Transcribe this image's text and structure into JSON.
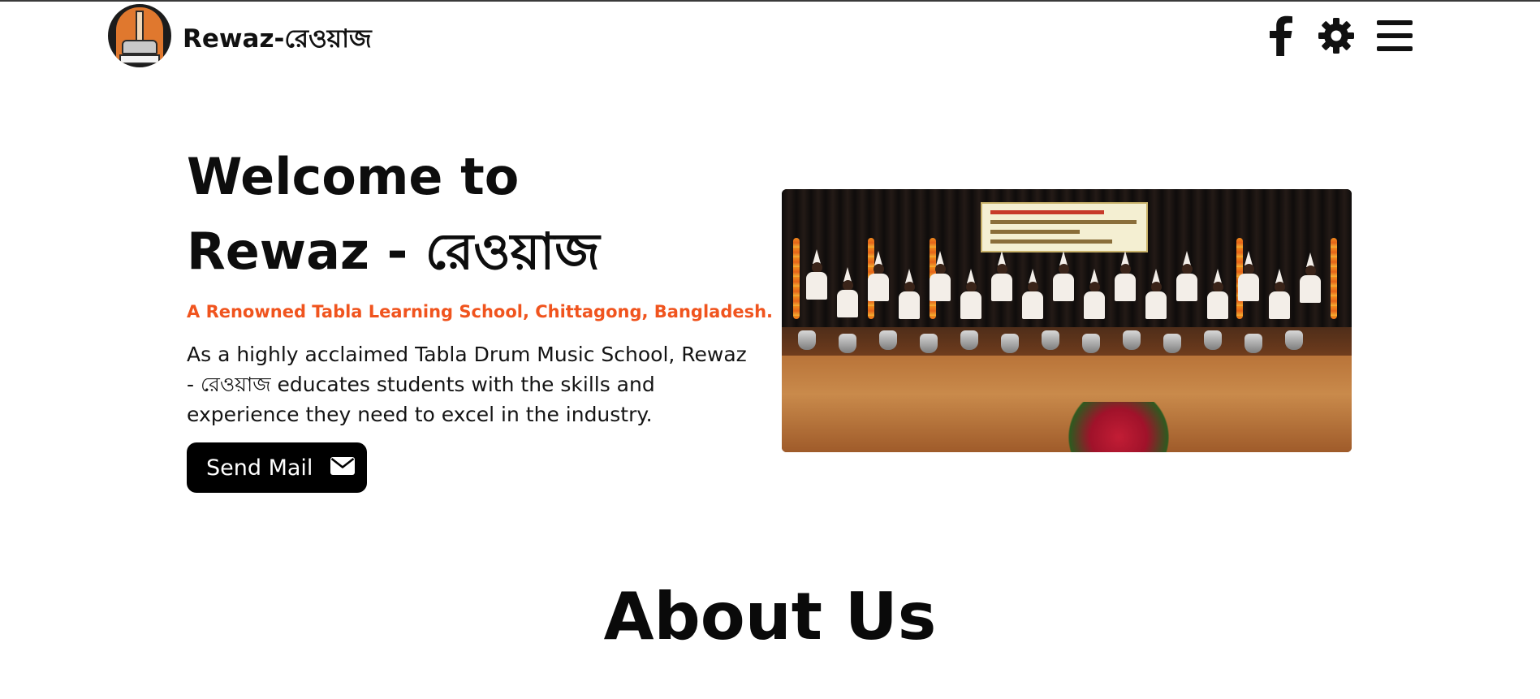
{
  "nav": {
    "brand": "Rewaz-রেওয়াজ",
    "logo_icon": "tabla-logo-icon",
    "icons": [
      "facebook-icon",
      "gear-icon",
      "hamburger-menu-icon"
    ]
  },
  "hero": {
    "title_line1": "Welcome to",
    "title_line2": "Rewaz - রেওয়াজ",
    "tagline": "A Renowned Tabla Learning School, Chittagong, Bangladesh.",
    "description": "As a highly acclaimed Tabla Drum Music School, Rewaz - রেওয়াজ educates students with the skills and experience they need to excel in the industry.",
    "button_label": "Send Mail",
    "button_icon": "envelope-icon",
    "image_subject": "tabla-performance-photo"
  },
  "about": {
    "title": "About Us"
  },
  "colors": {
    "accent": "#f0541e",
    "button_bg": "#000000",
    "text": "#111111",
    "background": "#ffffff"
  }
}
